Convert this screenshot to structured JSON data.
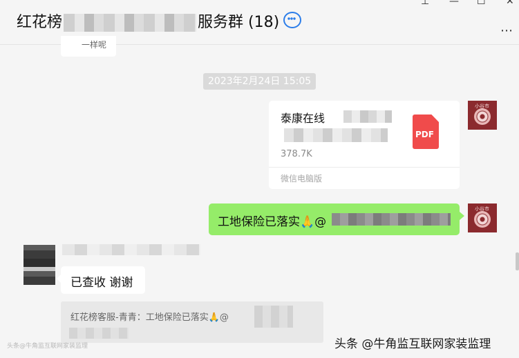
{
  "window": {
    "pin_icon": "pin-icon",
    "minimize_icon": "minimize-icon",
    "maximize_icon": "maximize-icon",
    "close_icon": "close-icon",
    "pin_glyph": "⊥",
    "minimize_glyph": "—",
    "maximize_glyph": "☐",
    "close_glyph": "✕"
  },
  "header": {
    "title_prefix": "红花榜",
    "title_suffix": "服务群 (18)",
    "more_glyph": "⋯"
  },
  "chat": {
    "top_stub_text": "一样呢",
    "timestamp": "2023年2月24日 15:05",
    "file_message": {
      "name": "泰康在线",
      "size": "378.7K",
      "type_label": "PDF",
      "source": "微信电脑版"
    },
    "sent_message": {
      "text": "工地保险已落实🙏@"
    },
    "received_message": {
      "text": "已查收 谢谢"
    },
    "quote": {
      "text": "红花榜客服-青青：工地保险已落实🙏@"
    },
    "avatar_text": "小谷市"
  },
  "watermarks": {
    "bottom_left": "头条@牛角监互联网家装监理",
    "bottom_right": "头条 @牛角监互联网家装监理"
  },
  "colors": {
    "sent_bubble": "#95ec69",
    "received_bubble": "#ffffff",
    "background": "#f5f5f5",
    "pdf_red": "#f04b4b",
    "avatar_red": "#8b2a2e"
  }
}
